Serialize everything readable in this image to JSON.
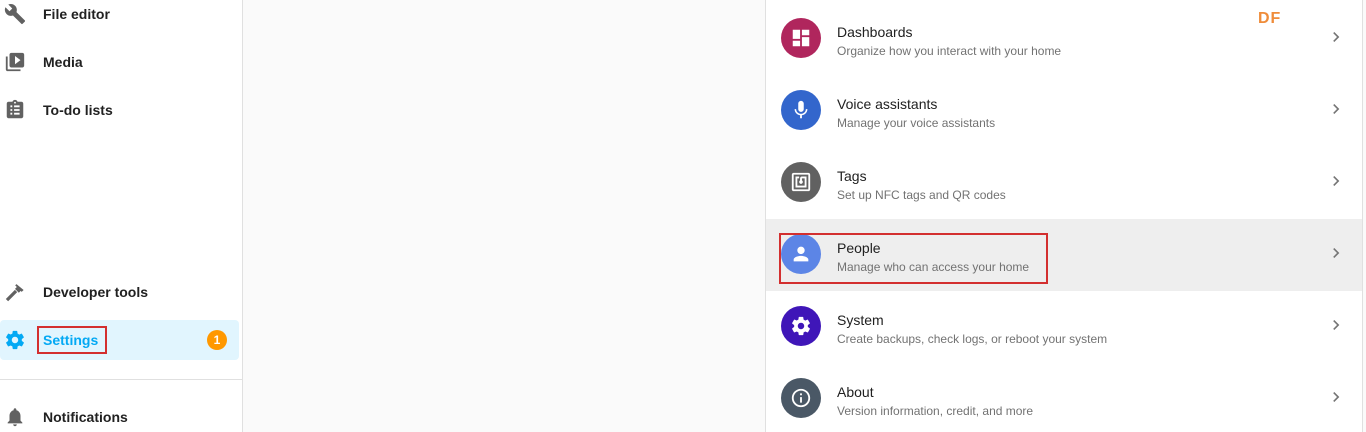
{
  "sidebar": {
    "items": [
      {
        "label": "File editor",
        "icon": "wrench-icon"
      },
      {
        "label": "Media",
        "icon": "media-play-icon"
      },
      {
        "label": "To-do lists",
        "icon": "clipboard-list-icon"
      },
      {
        "label": "Developer tools",
        "icon": "hammer-icon"
      },
      {
        "label": "Settings",
        "icon": "gear-icon",
        "badge": "1",
        "active": true
      },
      {
        "label": "Notifications",
        "icon": "bell-icon"
      }
    ]
  },
  "watermark": "DF",
  "settings_list": [
    {
      "title": "Dashboards",
      "description": "Organize how you interact with your home",
      "icon": "dashboard-icon",
      "color": "#b0265d"
    },
    {
      "title": "Voice assistants",
      "description": "Manage your voice assistants",
      "icon": "microphone-icon",
      "color": "#3366cc"
    },
    {
      "title": "Tags",
      "description": "Set up NFC tags and QR codes",
      "icon": "nfc-tag-icon",
      "color": "#616161"
    },
    {
      "title": "People",
      "description": "Manage who can access your home",
      "icon": "person-icon",
      "color": "#5c85e6"
    },
    {
      "title": "System",
      "description": "Create backups, check logs, or reboot your system",
      "icon": "gear-icon",
      "color": "#3f16b8"
    },
    {
      "title": "About",
      "description": "Version information, credit, and more",
      "icon": "info-icon",
      "color": "#4a5866"
    }
  ],
  "colors": {
    "accent": "#03a9f4",
    "badge": "#ff9800",
    "highlight": "#d32f2f"
  }
}
